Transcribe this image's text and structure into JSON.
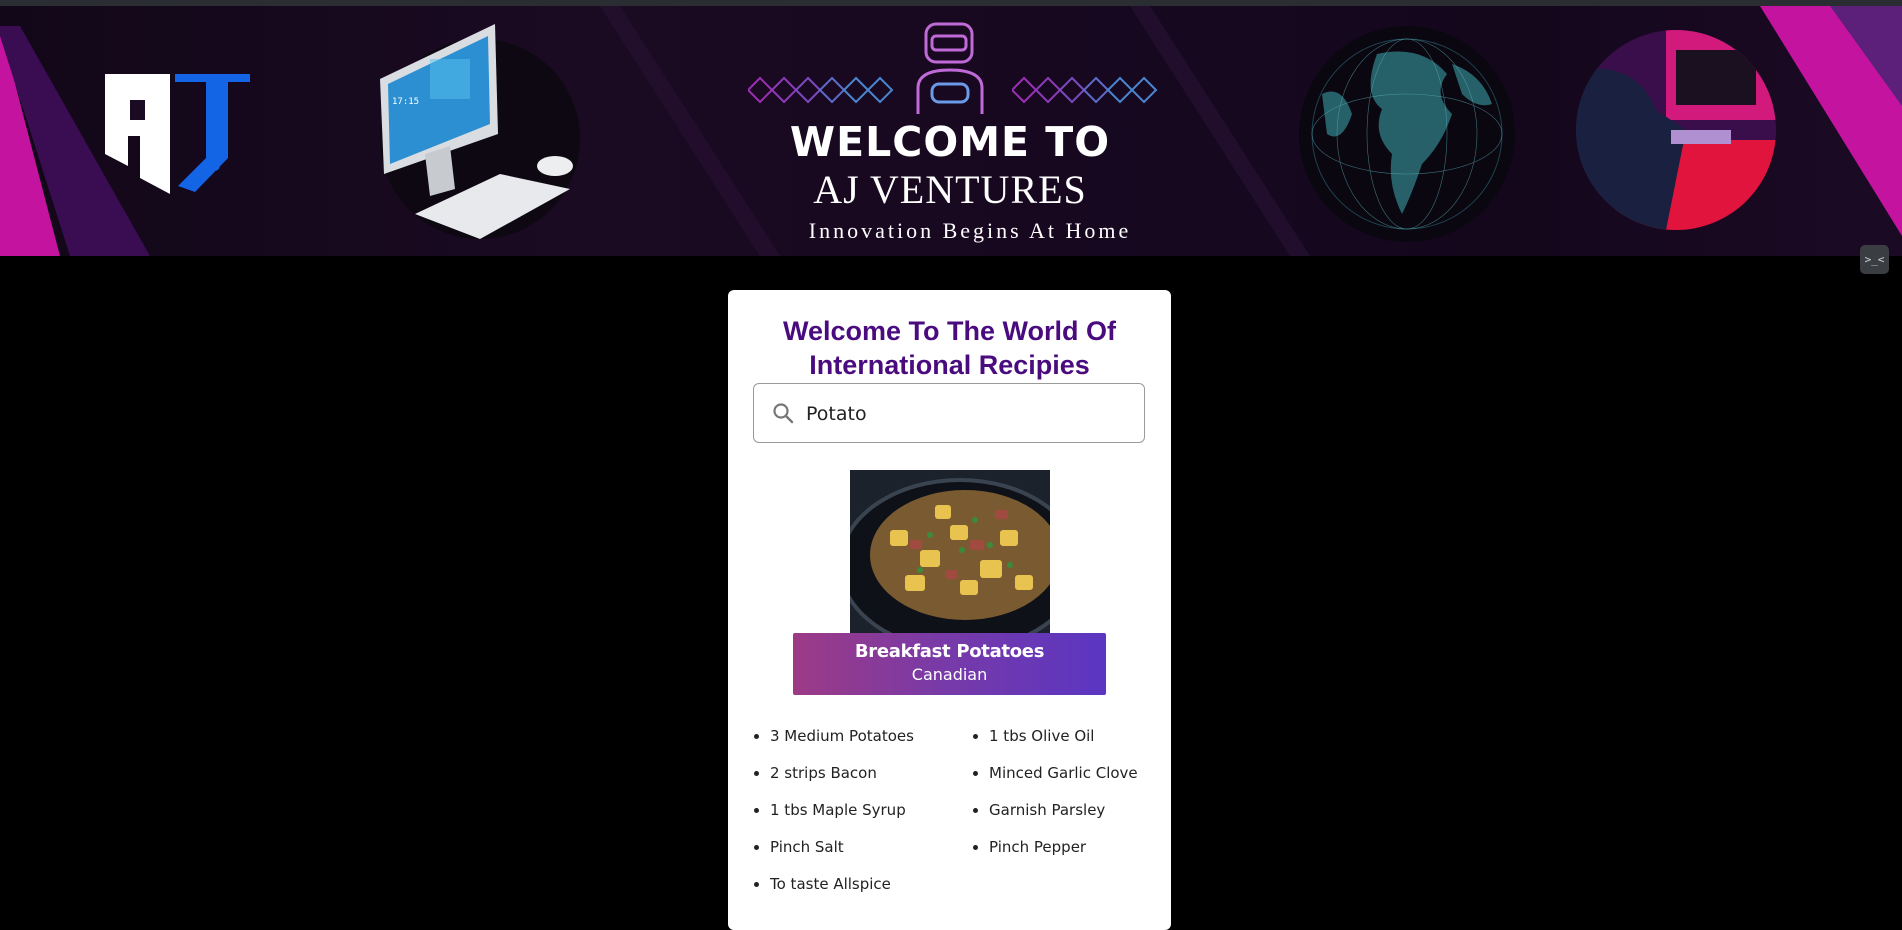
{
  "banner": {
    "logo_text": "AJ",
    "monitor_clock": "17:15",
    "headline_1": "WELCOME TO",
    "headline_2": "AJ VENTURES",
    "tagline": "Innovation Begins At Home"
  },
  "expand_button": {
    "label": ">_<"
  },
  "card": {
    "title_line_1": "Welcome To The World Of",
    "title_line_2": "International Recipies",
    "search": {
      "value": "Potato",
      "placeholder": ""
    },
    "recipe": {
      "name": "Breakfast Potatoes",
      "cuisine": "Canadian"
    },
    "ingredients": [
      "3 Medium Potatoes",
      "2 strips Bacon",
      "1 tbs Maple Syrup",
      "Pinch Salt",
      "To taste Allspice",
      "1 tbs Olive Oil",
      "Minced Garlic Clove",
      "Garnish Parsley",
      "Pinch Pepper"
    ]
  },
  "colors": {
    "title": "#4a0b7f",
    "accent_pink": "#d21aa8",
    "accent_purple": "#5a36c2",
    "banner_bg": "#14071c"
  }
}
